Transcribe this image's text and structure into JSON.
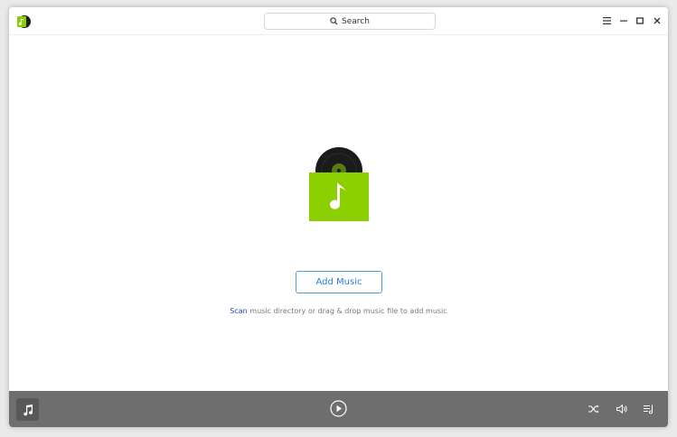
{
  "app": {
    "logo_icon": "music-app-logo",
    "accent_color": "#8ccf00",
    "link_color": "#1f3fd1"
  },
  "titlebar": {
    "search_label": "Search",
    "menu_icon": "hamburger-menu-icon",
    "minimize_icon": "minimize-icon",
    "maximize_icon": "maximize-icon",
    "close_icon": "close-icon"
  },
  "empty_state": {
    "art_icon": "vinyl-album-icon",
    "add_button_label": "Add Music",
    "hint_link": "Scan",
    "hint_text": " music directory or drag & drop music file to add music"
  },
  "playbar": {
    "cover_icon": "music-note-icon",
    "play_icon": "play-icon",
    "shuffle_icon": "shuffle-icon",
    "volume_icon": "volume-icon",
    "playlist_icon": "playlist-icon"
  }
}
